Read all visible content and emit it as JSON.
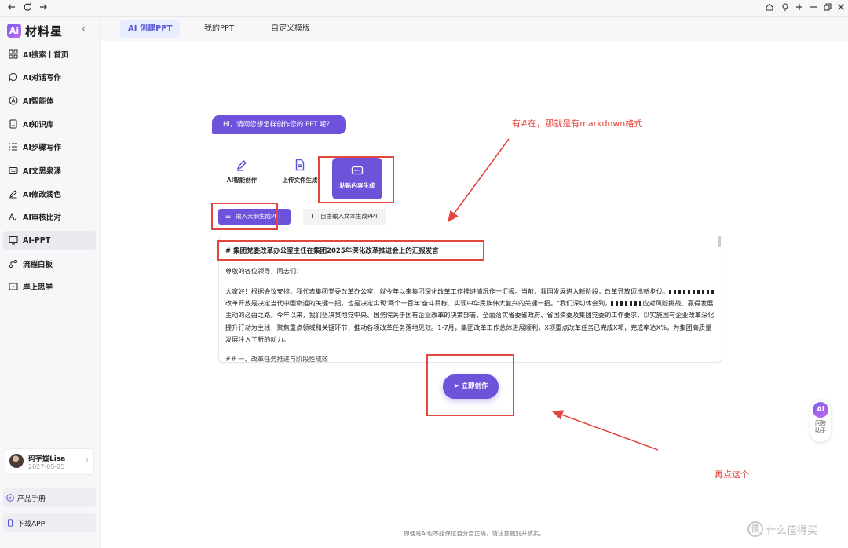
{
  "app": {
    "logo_badge": "Ai",
    "logo_text": "材料星",
    "collapse_icon": "chevron-left-icon"
  },
  "sidebar": {
    "items": [
      {
        "label": "AI搜索丨首页",
        "icon": "grid-icon"
      },
      {
        "label": "AI对话写作",
        "icon": "chat-bubble-icon"
      },
      {
        "label": "AI智能体",
        "icon": "ai-agent-icon"
      },
      {
        "label": "AI知识库",
        "icon": "book-icon"
      },
      {
        "label": "AI步骤写作",
        "icon": "steps-list-icon"
      },
      {
        "label": "AI文思泉涌",
        "icon": "keyboard-icon"
      },
      {
        "label": "AI修改润色",
        "icon": "pen-icon"
      },
      {
        "label": "AI审核比对",
        "icon": "text-compare-icon"
      },
      {
        "label": "AI-PPT",
        "icon": "monitor-icon",
        "active": true
      },
      {
        "label": "流程白板",
        "icon": "flow-icon"
      },
      {
        "label": "岸上思学",
        "icon": "play-screen-icon"
      }
    ],
    "user": {
      "name": "码字媛Lisa",
      "date": "2027-05-25"
    },
    "bottom_links": [
      {
        "label": "产品手册",
        "icon": "compass-icon"
      },
      {
        "label": "下载APP",
        "icon": "phone-icon"
      }
    ]
  },
  "tabs": [
    {
      "label": "AI 创建PPT",
      "active": true
    },
    {
      "label": "我的PPT",
      "active": false
    },
    {
      "label": "自定义模版",
      "active": false
    }
  ],
  "chat_prompt": "Hi，请问您想怎样创作您的 PPT 呢?",
  "modes": [
    {
      "label": "AI智能创作",
      "icon": "pen-sparkle-icon"
    },
    {
      "label": "上传文件生成",
      "icon": "document-icon"
    },
    {
      "label": "粘贴内容生成",
      "icon": "chat-dots-icon",
      "active": true
    }
  ],
  "sub_tabs": [
    {
      "label": "输入大纲生成PPT",
      "icon": "outline-icon",
      "active": true
    },
    {
      "label": "自由输入文本生成PPT",
      "icon": "text-T-icon",
      "active": false
    }
  ],
  "editor": {
    "heading": "# 集团党委改革办公室主任在集团2025年深化改革推进会上的汇报发言",
    "salutation": "尊敬的各位领导，同志们：",
    "para_p1": "大家好！根据会议安排，我代表集团党委改革办公室，就今年以来集团深化改革工作推进情况作一汇报。当前，我国发展进入新阶段，改革开放迈出新步伐。",
    "para_p2": "改革开放是决定当代中国命运的关键一招，也是决定实现'两个一百年'奋斗目标、实现中华民族伟大复兴的关键一招。\"我们深切体会到，",
    "para_p3": "应对风险挑战、赢得发展主动的必由之路。今年以来，我们坚决贯彻党中央、国务院关于国有企业改革的决策部署，全面落实省委省政府、省国资委及集团党委的工作要求，以实施国有企业改革深化提升行动为主线，聚焦重点领域和关键环节，推动各项改革任务落地见效。1-7月，集团改革工作总体进展顺利，X项重点改革任务已完成X项，完成率达X%，为集团高质量发展注入了新的动力。",
    "next_heading": "## 一、改革任务推进与阶段性成效"
  },
  "go_button": "立即创作",
  "go_icon": "send-icon",
  "disclaimer": "即便是AI也不能保证百分百正确，请注意甄别并核实。",
  "helper": {
    "badge": "Ai",
    "label_1": "问答",
    "label_2": "助手"
  },
  "annotations": {
    "note_markdown": "有#在，那就是有markdown格式",
    "note_click": "再点这个",
    "color": "#e2463e"
  },
  "watermark": {
    "logo": "值",
    "text": "什么值得买"
  },
  "colors": {
    "accent": "#6e52d9",
    "active_tab_bg": "#e8ecff"
  }
}
